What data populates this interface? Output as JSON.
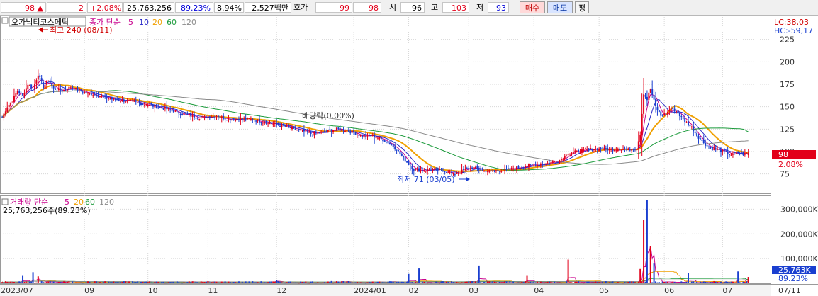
{
  "quote": {
    "price": "98",
    "direction": "▲",
    "change": "2",
    "change_pct": "+2.08%",
    "volume": "25,763,256",
    "vol_ratio": "89.23%",
    "turnover": "8.94%",
    "amount": "2,527백만",
    "hoga_label": "호가",
    "ask": "99",
    "bid": "98",
    "open_label": "시",
    "open": "96",
    "high_label": "고",
    "high": "103",
    "low_label": "저",
    "low": "93",
    "buy_label": "매수",
    "sell_label": "매도",
    "avg_label": "평"
  },
  "price_panel": {
    "stock_name": "오가닉티코스메틱",
    "series_label": "종가 단순",
    "ma_labels": [
      "5",
      "10",
      "20",
      "60",
      "120"
    ],
    "ma_colors": [
      "#c8008c",
      "#2828c8",
      "#f0a000",
      "#1a9a3a",
      "#8a8a8a"
    ],
    "lc_text": "LC:38,03",
    "hc_text": "HC:-59,17",
    "high_annotation": "최고 240 (08/11)",
    "low_annotation": "최저 71 (03/05)",
    "dividend_annotation": "배당락(0.00%)",
    "current_price_tag": "98",
    "current_change_tag": "2.08%"
  },
  "volume_panel": {
    "series_label": "거래량 단순",
    "ma_labels": [
      "5",
      "20",
      "60",
      "120"
    ],
    "volume_text": "25,763,256주(89.23%)",
    "current_volume_tag": "25,763K",
    "current_ratio_tag": "89.23%"
  },
  "colors": {
    "up": "#e2001a",
    "down": "#1a3fd0",
    "grid": "#d7d7d7",
    "tag_bg": "#e2001a",
    "vol_tag_bg": "#1a3fd0"
  },
  "chart_data": {
    "type": "candlestick",
    "x_tick_labels": [
      "2023/07",
      "09",
      "10",
      "11",
      "12",
      "2024/01",
      "02",
      "03",
      "04",
      "05",
      "06",
      "07",
      "07/11"
    ],
    "price_axis": {
      "ticks": [
        75,
        100,
        125,
        150,
        175,
        200,
        225
      ],
      "ylim": [
        55,
        250
      ]
    },
    "volume_axis": {
      "ticks": [
        "100,000K",
        "200,000K",
        "300,000K"
      ],
      "tick_values": [
        100000,
        200000,
        300000
      ],
      "ylim": [
        0,
        350000
      ],
      "unit": "K"
    },
    "price_anchors": [
      [
        0,
        138
      ],
      [
        3,
        150
      ],
      [
        6,
        157
      ],
      [
        9,
        168
      ],
      [
        12,
        162
      ],
      [
        15,
        175
      ],
      [
        18,
        170
      ],
      [
        21,
        186
      ],
      [
        24,
        172
      ],
      [
        27,
        180
      ],
      [
        30,
        170
      ],
      [
        35,
        168
      ],
      [
        40,
        172
      ],
      [
        45,
        168
      ],
      [
        50,
        165
      ],
      [
        55,
        163
      ],
      [
        60,
        160
      ],
      [
        65,
        158
      ],
      [
        70,
        157
      ],
      [
        75,
        156
      ],
      [
        80,
        154
      ],
      [
        85,
        152
      ],
      [
        90,
        150
      ],
      [
        95,
        148
      ],
      [
        100,
        145
      ],
      [
        105,
        142
      ],
      [
        110,
        140
      ],
      [
        115,
        138
      ],
      [
        120,
        139
      ],
      [
        125,
        140
      ],
      [
        130,
        137
      ],
      [
        135,
        136
      ],
      [
        140,
        137
      ],
      [
        145,
        136
      ],
      [
        150,
        134
      ],
      [
        155,
        132
      ],
      [
        160,
        130
      ],
      [
        165,
        128
      ],
      [
        170,
        125
      ],
      [
        175,
        123
      ],
      [
        180,
        120
      ],
      [
        185,
        121
      ],
      [
        190,
        123
      ],
      [
        195,
        125
      ],
      [
        200,
        124
      ],
      [
        205,
        121
      ],
      [
        210,
        117
      ],
      [
        215,
        118
      ],
      [
        220,
        115
      ],
      [
        225,
        110
      ],
      [
        230,
        103
      ],
      [
        235,
        90
      ],
      [
        240,
        80
      ],
      [
        245,
        79
      ],
      [
        250,
        80
      ],
      [
        255,
        79
      ],
      [
        260,
        78
      ],
      [
        263,
        74
      ],
      [
        266,
        77
      ],
      [
        270,
        80
      ],
      [
        275,
        82
      ],
      [
        280,
        79
      ],
      [
        285,
        78
      ],
      [
        290,
        79
      ],
      [
        295,
        80
      ],
      [
        300,
        82
      ],
      [
        305,
        84
      ],
      [
        310,
        85
      ],
      [
        315,
        86
      ],
      [
        320,
        88
      ],
      [
        325,
        90
      ],
      [
        330,
        98
      ],
      [
        335,
        100
      ],
      [
        340,
        102
      ],
      [
        345,
        103
      ],
      [
        350,
        103
      ],
      [
        355,
        102
      ],
      [
        360,
        103
      ],
      [
        365,
        102
      ],
      [
        370,
        104
      ],
      [
        372,
        120
      ],
      [
        374,
        165
      ],
      [
        376,
        158
      ],
      [
        378,
        170
      ],
      [
        381,
        150
      ],
      [
        384,
        140
      ],
      [
        387,
        142
      ],
      [
        390,
        148
      ],
      [
        393,
        145
      ],
      [
        396,
        138
      ],
      [
        399,
        132
      ],
      [
        402,
        127
      ],
      [
        405,
        118
      ],
      [
        408,
        112
      ],
      [
        411,
        106
      ],
      [
        414,
        103
      ],
      [
        417,
        102
      ],
      [
        420,
        100
      ],
      [
        423,
        98
      ],
      [
        426,
        96
      ],
      [
        429,
        99
      ],
      [
        432,
        97
      ],
      [
        435,
        98
      ]
    ],
    "volume_spikes": [
      {
        "index": 12,
        "value": 30000
      },
      {
        "index": 18,
        "value": 45000
      },
      {
        "index": 21,
        "value": 28000
      },
      {
        "index": 160,
        "value": 12000
      },
      {
        "index": 192,
        "value": 9000
      },
      {
        "index": 237,
        "value": 38000
      },
      {
        "index": 243,
        "value": 60000
      },
      {
        "index": 278,
        "value": 72000
      },
      {
        "index": 306,
        "value": 30000
      },
      {
        "index": 330,
        "value": 96000
      },
      {
        "index": 372,
        "value": 58000
      },
      {
        "index": 374,
        "value": 258000
      },
      {
        "index": 376,
        "value": 336000
      },
      {
        "index": 378,
        "value": 150000
      },
      {
        "index": 380,
        "value": 80000
      },
      {
        "index": 400,
        "value": 42000
      },
      {
        "index": 429,
        "value": 48000
      }
    ],
    "last": {
      "open": 96,
      "high": 103,
      "low": 93,
      "close": 98,
      "volume": 25763256
    }
  }
}
